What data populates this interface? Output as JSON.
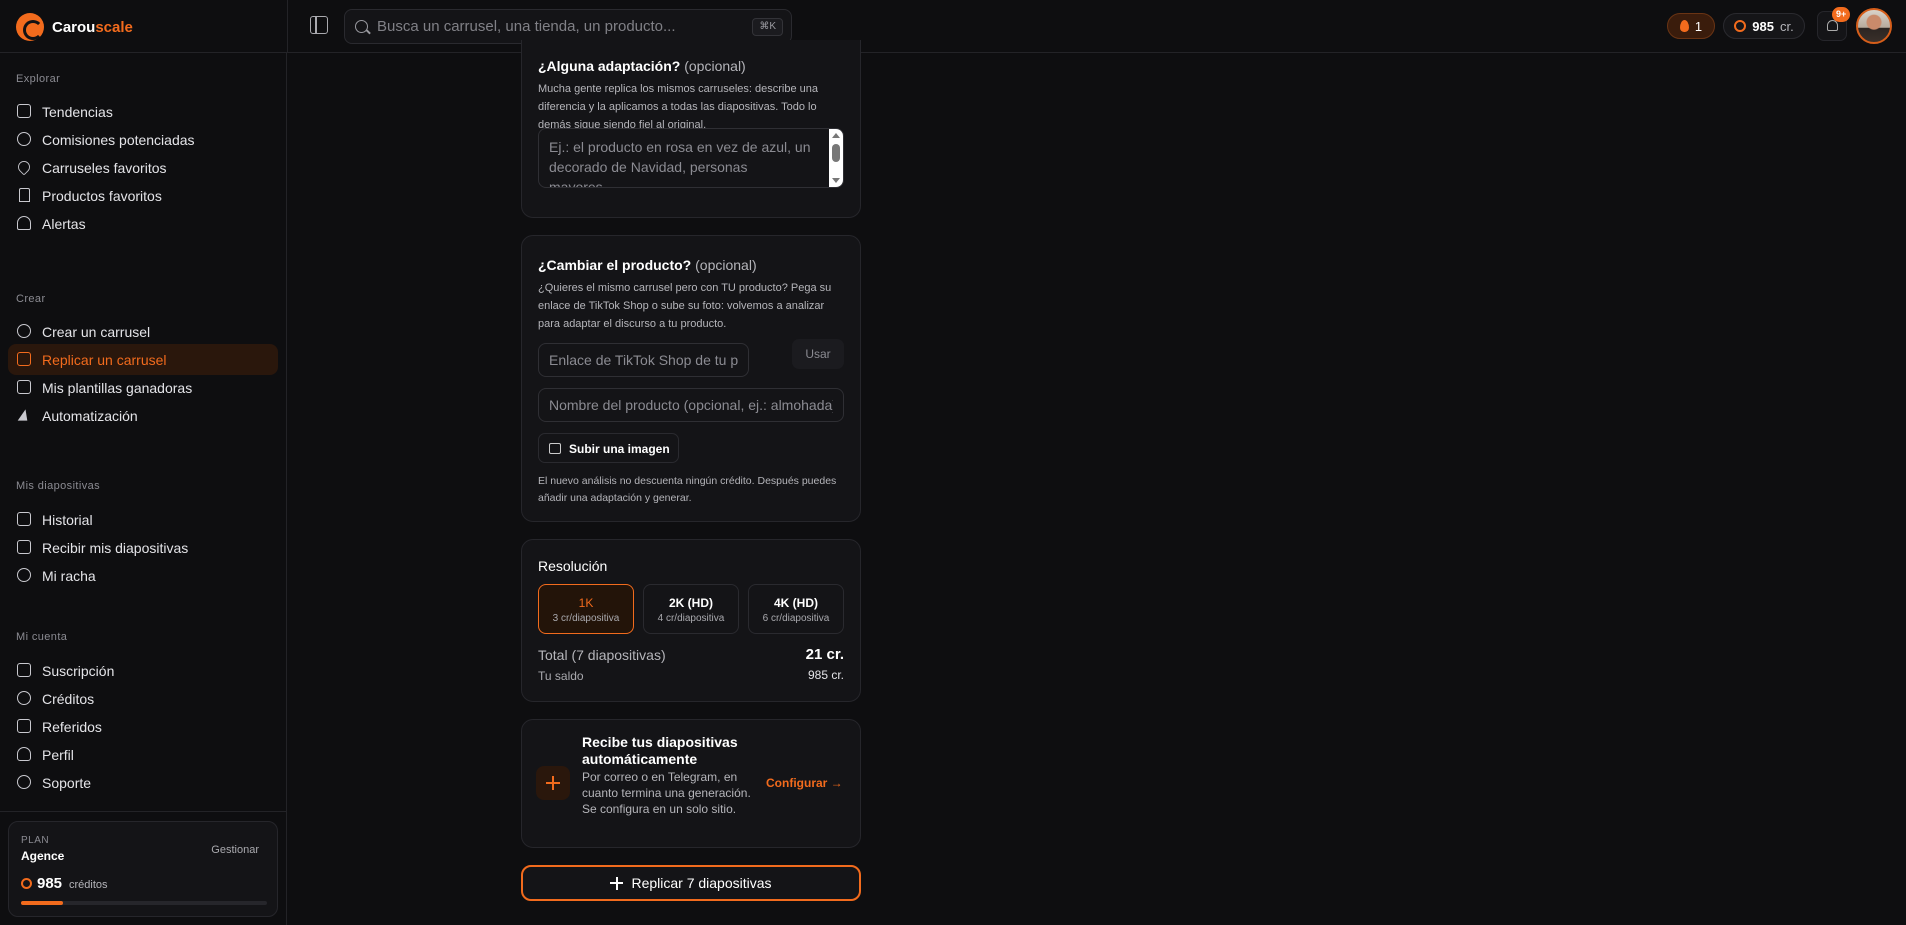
{
  "app": {
    "logo_text_a": "Carou",
    "logo_text_b": "scale",
    "search_placeholder": "Busca un carrusel, una tienda, un producto...",
    "search_shortcut": "⌘K",
    "streak_count": "1",
    "credits_value": "985",
    "credits_unit": "cr.",
    "notifications_badge": "9+",
    "accent_color": "#f26b1d"
  },
  "sidebar": {
    "sections": [
      {
        "title": "Explorar",
        "items": [
          {
            "label": "Tendencias",
            "icon": "grid-icon"
          },
          {
            "label": "Comisiones potenciadas",
            "icon": "percent-icon"
          },
          {
            "label": "Carruseles favoritos",
            "icon": "heart-icon"
          },
          {
            "label": "Productos favoritos",
            "icon": "bookmark-icon"
          },
          {
            "label": "Alertas",
            "icon": "bell-icon"
          }
        ]
      },
      {
        "title": "Crear",
        "items": [
          {
            "label": "Crear un carrusel",
            "icon": "sparkles-icon"
          },
          {
            "label": "Replicar un carrusel",
            "icon": "repeat-icon",
            "active": true
          },
          {
            "label": "Mis plantillas ganadoras",
            "icon": "trophy-icon"
          },
          {
            "label": "Automatización",
            "icon": "bolt-icon"
          }
        ]
      },
      {
        "title": "Mis diapositivas",
        "items": [
          {
            "label": "Historial",
            "icon": "image-icon"
          },
          {
            "label": "Recibir mis diapositivas",
            "icon": "send-icon"
          },
          {
            "label": "Mi racha",
            "icon": "flame-icon"
          }
        ]
      },
      {
        "title": "Mi cuenta",
        "items": [
          {
            "label": "Suscripción",
            "icon": "crown-icon"
          },
          {
            "label": "Créditos",
            "icon": "coins-icon"
          },
          {
            "label": "Referidos",
            "icon": "gift-icon"
          },
          {
            "label": "Perfil",
            "icon": "user-icon"
          },
          {
            "label": "Soporte",
            "icon": "lifebuoy-icon"
          }
        ]
      }
    ],
    "plan": {
      "label": "PLAN",
      "name": "Agence",
      "manage": "Gestionar",
      "credits": "985",
      "credits_unit": "créditos",
      "usage_fraction": 0.17
    }
  },
  "adaptation": {
    "title": "¿Alguna adaptación?",
    "optional": "(opcional)",
    "description": "Mucha gente replica los mismos carruseles: describe una diferencia y la aplicamos a todas las diapositivas. Todo lo demás sigue siendo fiel al original.",
    "placeholder": "Ej.: el producto en rosa en vez de azul, un decorado de Navidad, personas mayores..."
  },
  "change_product": {
    "title": "¿Cambiar el producto?",
    "optional": "(opcional)",
    "description": "¿Quieres el mismo carrusel pero con TU producto? Pega su enlace de TikTok Shop o sube su foto: volvemos a analizar para adaptar el discurso a tu producto.",
    "link_placeholder": "Enlace de TikTok Shop de tu producto",
    "use_label": "Usar",
    "name_placeholder": "Nombre del producto (opcional, ej.: almohada)",
    "upload_label": "Subir una imagen",
    "note": "El nuevo análisis no descuenta ningún crédito. Después puedes añadir una adaptación y generar."
  },
  "resolution": {
    "title": "Resolución",
    "options": [
      {
        "name": "1K",
        "price": "3 cr/diapositiva",
        "selected": true
      },
      {
        "name": "2K (HD)",
        "price": "4 cr/diapositiva"
      },
      {
        "name": "4K (HD)",
        "price": "6 cr/diapositiva"
      }
    ],
    "total_label": "Total (7 diapositivas)",
    "total_value": "21 cr.",
    "balance_label": "Tu saldo",
    "balance_value": "985 cr."
  },
  "auto_delivery": {
    "title": "Recibe tus diapositivas automáticamente",
    "description": "Por correo o en Telegram, en cuanto termina una generación. Se configura en un solo sitio.",
    "configure_label": "Configurar →"
  },
  "cta": {
    "label": "Replicar 7 diapositivas"
  }
}
